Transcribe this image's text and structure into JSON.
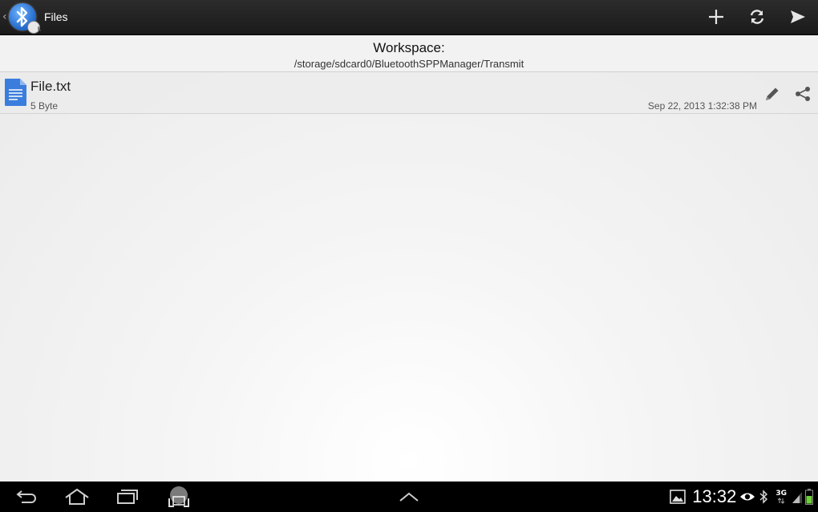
{
  "actionbar": {
    "title": "Files",
    "actions": [
      "add-icon",
      "refresh-icon",
      "send-icon"
    ]
  },
  "workspace": {
    "label": "Workspace:",
    "path": "/storage/sdcard0/BluetoothSPPManager/Transmit"
  },
  "files": [
    {
      "name": "File.txt",
      "size": "5 Byte",
      "date": "Sep 22, 2013 1:32:38 PM"
    }
  ],
  "statusbar": {
    "time": "13:32",
    "network": "3G"
  },
  "colors": {
    "actionbar_bg": "#1f1f1f",
    "file_icon": "#3b7ddd",
    "navbar_bg": "#000000",
    "battery": "#6cd136"
  }
}
